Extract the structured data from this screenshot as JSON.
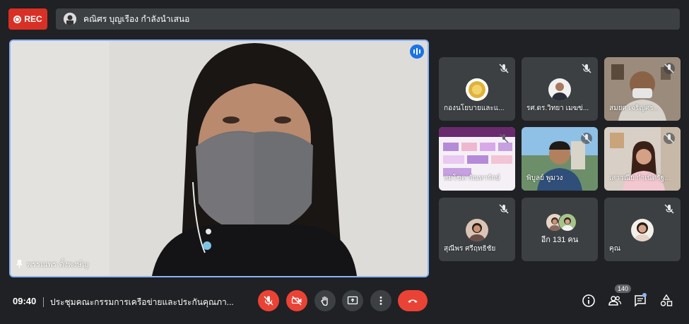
{
  "rec_label": "REC",
  "presenting_text": "คณิศร บุญเรือง กำลังนำเสนอ",
  "main_speaker": {
    "name": "พรรณพร ตั้งพงษ์ญ"
  },
  "tiles": [
    {
      "name": "กองนโยบายและแ..."
    },
    {
      "name": "รศ.ดร.วิทยา เมฆข่..."
    },
    {
      "name": "สมยศ เจริญศร..."
    },
    {
      "name": "สมโชค กัณหารักษ์"
    },
    {
      "name": "พิบูลย์ พูมวง"
    },
    {
      "name": "เสาวณีย์ กำเนิดรัฐ..."
    },
    {
      "name": "สุณีพร ศรีฤทธิชัย"
    },
    {
      "name": "อีก 131 คน"
    },
    {
      "name": "คุณ"
    }
  ],
  "bottom": {
    "time": "09:40",
    "meeting_title": "ประชุมคณะกรรมการเครือข่ายและประกันคุณภา...",
    "participant_count": "140"
  },
  "colors": {
    "accent": "#8ab4f8",
    "end_call": "#ea4335",
    "rec": "#d93025",
    "background": "#202124"
  }
}
